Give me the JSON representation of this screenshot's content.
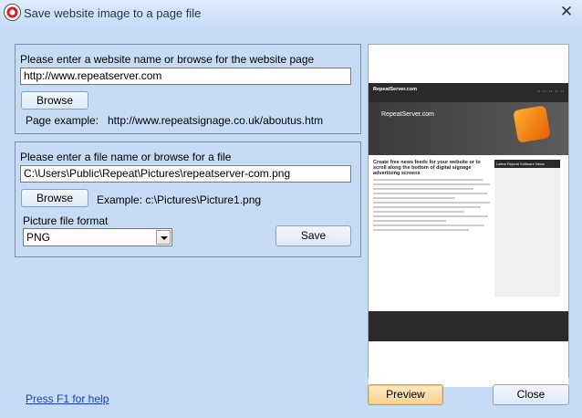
{
  "window": {
    "title": "Save website image to a page file"
  },
  "website_group": {
    "prompt": "Please enter a website name or browse for the website page",
    "url_value": "http://www.repeatserver.com",
    "browse_label": "Browse",
    "example_label": "Page example:",
    "example_value": "http://www.repeatsignage.co.uk/aboutus.htm"
  },
  "file_group": {
    "prompt": "Please enter a file name or browse for a file",
    "path_value": "C:\\Users\\Public\\Repeat\\Pictures\\repeatserver-com.png",
    "browse_label": "Browse",
    "example_text": "Example: c:\\Pictures\\Picture1.png",
    "format_label": "Picture file format",
    "format_selected": "PNG",
    "save_label": "Save"
  },
  "preview_page": {
    "brand": "RepeatServer.com",
    "banner_text": "RepeatServer.com",
    "headline": "Create free news feeds for your website or to scroll along the bottom of digital signage advertising screens",
    "sidebar_title": "Latest Repeat Software News"
  },
  "footer": {
    "help_link": "Press F1 for help",
    "preview_label": "Preview",
    "close_label": "Close"
  }
}
